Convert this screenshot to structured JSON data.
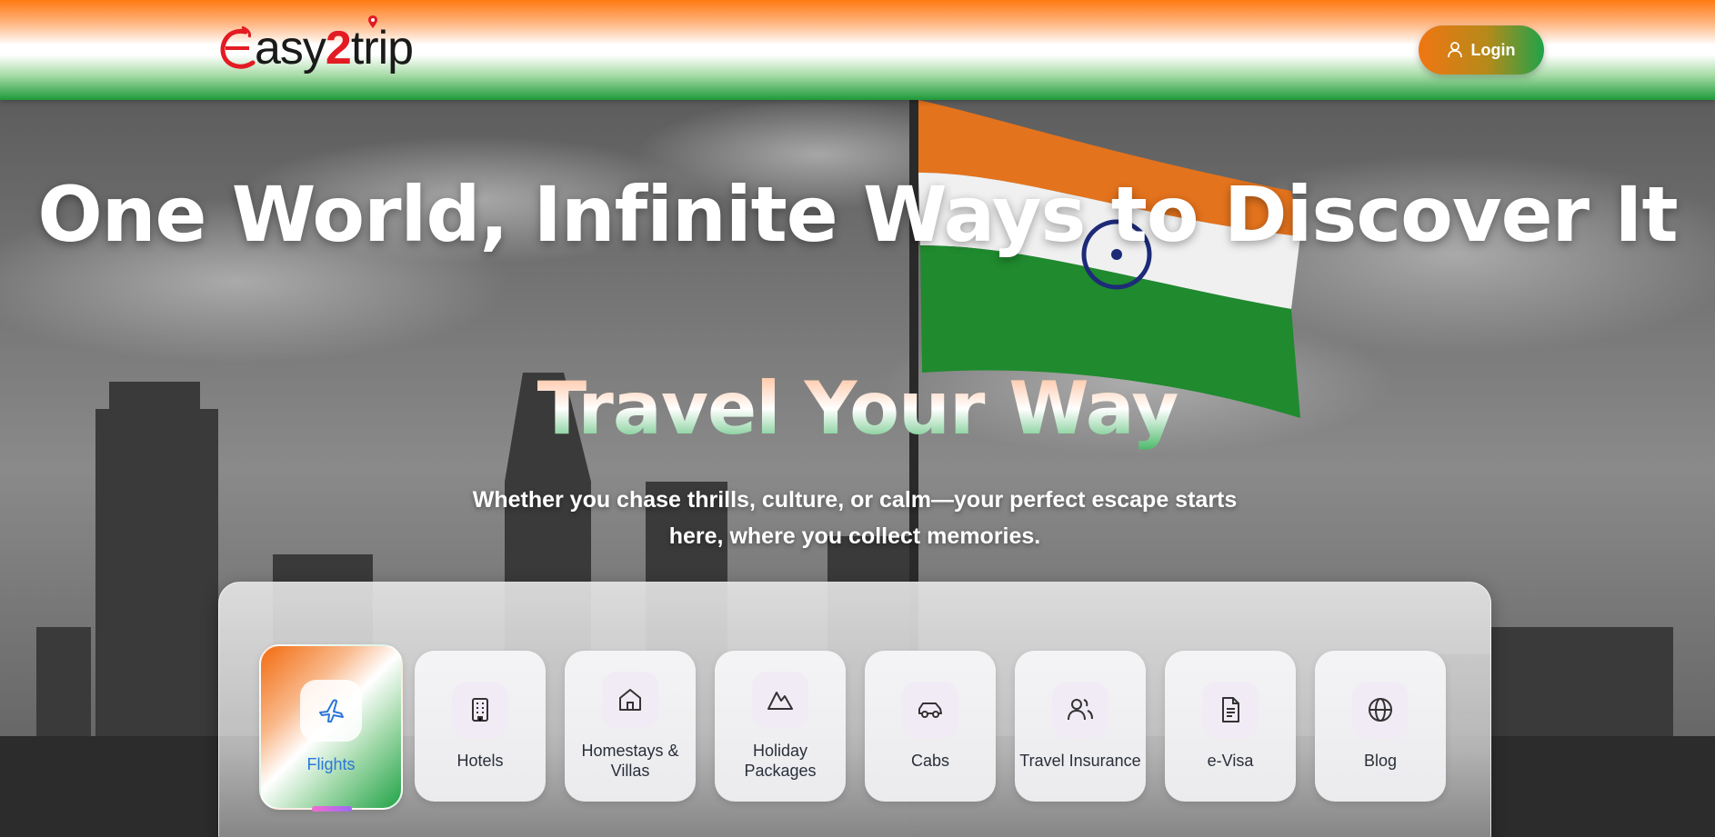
{
  "brand": {
    "logo_word1": "asy",
    "logo_number": "2",
    "logo_word2": "trip"
  },
  "header": {
    "login_label": "Login",
    "login_icon": "user-icon"
  },
  "hero": {
    "headline": "One World, Infinite Ways to Discover It",
    "tagline": "Travel Your Way",
    "subtitle": "Whether you chase thrills, culture, or calm—your perfect escape starts here, where you collect memories."
  },
  "services": [
    {
      "label": "Flights",
      "icon": "plane-icon",
      "active": true
    },
    {
      "label": "Hotels",
      "icon": "building-icon",
      "active": false
    },
    {
      "label": "Homestays & Villas",
      "icon": "home-icon",
      "active": false
    },
    {
      "label": "Holiday Packages",
      "icon": "mountain-icon",
      "active": false
    },
    {
      "label": "Cabs",
      "icon": "car-icon",
      "active": false
    },
    {
      "label": "Travel Insurance",
      "icon": "users-icon",
      "active": false
    },
    {
      "label": "e-Visa",
      "icon": "document-icon",
      "active": false
    },
    {
      "label": "Blog",
      "icon": "globe-icon",
      "active": false
    }
  ],
  "colors": {
    "saffron": "#f07612",
    "green": "#1fa34a",
    "brand_red": "#e31b23",
    "active_label": "#2a78d8"
  }
}
